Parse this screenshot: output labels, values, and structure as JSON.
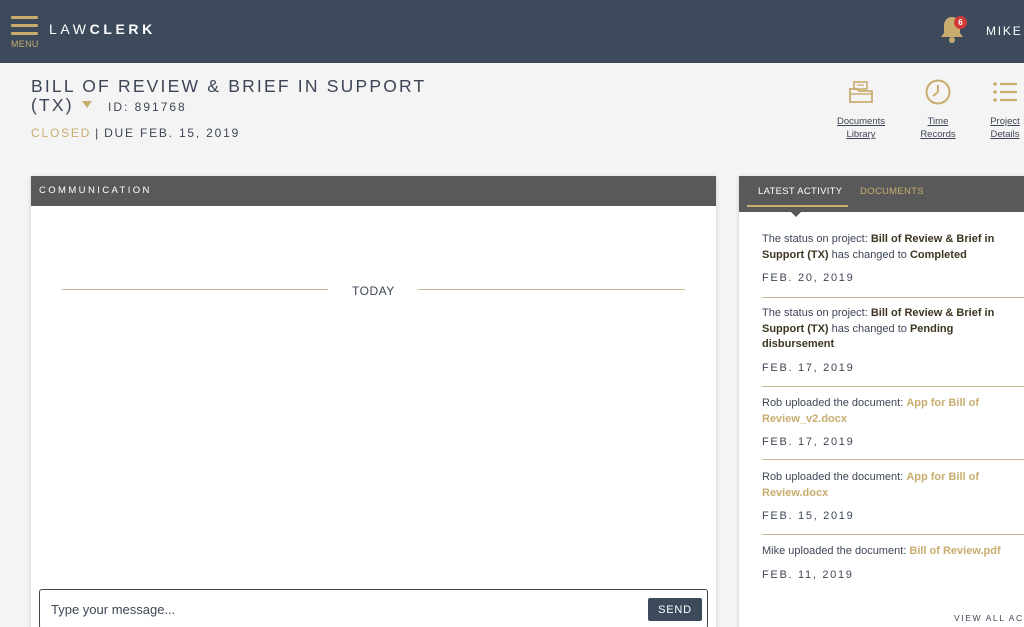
{
  "topbar": {
    "menu_label": "MENU",
    "logo_light": "LAW",
    "logo_bold": "CLERK",
    "notification_count": "6",
    "user_name": "MIKE"
  },
  "project": {
    "title_line1": "BILL OF REVIEW & BRIEF IN SUPPORT",
    "title_line2": "(TX)",
    "id": "ID: 891768",
    "status": "CLOSED",
    "separator": "|",
    "due": "DUE FEB. 15, 2019"
  },
  "quick_links": [
    {
      "line1": "Documents",
      "line2": "Library",
      "icon": "folder-icon"
    },
    {
      "line1": "Time",
      "line2": "Records",
      "icon": "clock-icon"
    },
    {
      "line1": "Project",
      "line2": "Details",
      "icon": "list-icon"
    }
  ],
  "communication": {
    "header": "COMMUNICATION",
    "day_label": "TODAY",
    "message_placeholder": "Type your message...",
    "send_label": "SEND"
  },
  "activity": {
    "tabs": {
      "latest": "LATEST ACTIVITY",
      "documents": "DOCUMENTS"
    },
    "items": [
      {
        "prefix": "The status on project: ",
        "project": "Bill of Review & Brief in Support (TX)",
        "middle": " has changed to ",
        "status": "Completed",
        "date": "FEB. 20, 2019"
      },
      {
        "prefix": "The status on project: ",
        "project": "Bill of Review & Brief in Support (TX)",
        "middle": " has changed to ",
        "status": "Pending disbursement",
        "date": "FEB. 17, 2019"
      },
      {
        "prefix": "Rob uploaded the document: ",
        "doc": "App for Bill of Review_v2.docx",
        "date": "FEB. 17, 2019"
      },
      {
        "prefix": "Rob uploaded the document: ",
        "doc": "App for Bill of Review.docx",
        "date": "FEB. 15, 2019"
      },
      {
        "prefix": "Mike uploaded the document: ",
        "doc": "Bill of Review.pdf",
        "date": "FEB. 11, 2019"
      }
    ],
    "view_all": "VIEW ALL ACTIVITY"
  },
  "colors": {
    "topbar": "#3c4a5c",
    "accent_gold": "#c8ad6e",
    "panel_header": "#595959",
    "text": "#3d4656",
    "badge": "#d23a3a"
  }
}
